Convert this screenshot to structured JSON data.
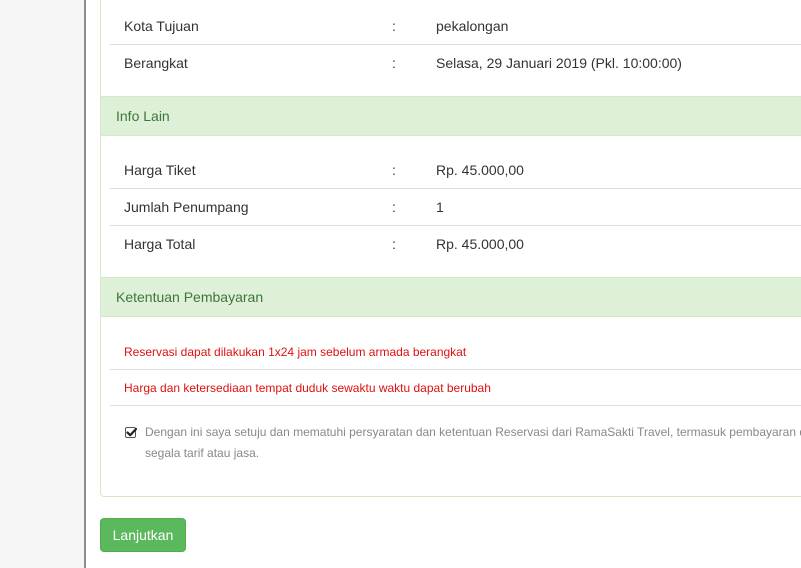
{
  "trip": {
    "rows": [
      {
        "label": "Kota Tujuan",
        "colon": ":",
        "value": "pekalongan"
      },
      {
        "label": "Berangkat",
        "colon": ":",
        "value": "Selasa, 29 Januari 2019 (Pkl. 10:00:00)"
      }
    ]
  },
  "info_lain": {
    "heading": "Info Lain",
    "rows": [
      {
        "label": "Harga Tiket",
        "colon": ":",
        "value": "Rp. 45.000,00"
      },
      {
        "label": "Jumlah Penumpang",
        "colon": ":",
        "value": "1"
      },
      {
        "label": "Harga Total",
        "colon": ":",
        "value": "Rp. 45.000,00"
      }
    ]
  },
  "ketentuan": {
    "heading": "Ketentuan Pembayaran",
    "notices": [
      "Reservasi dapat dilakukan 1x24 jam sebelum armada berangkat",
      "Harga dan ketersediaan tempat duduk sewaktu waktu dapat berubah"
    ],
    "agreement": {
      "checked": true,
      "text": "Dengan ini saya setuju dan mematuhi persyaratan dan ketentuan Reservasi dari RamaSakti Travel, termasuk pembayaran dari segala tarif atau jasa."
    }
  },
  "actions": {
    "next_label": "Lanjutkan"
  },
  "colors": {
    "panel_border": "#d6e9c6",
    "section_bg": "#dff0d8",
    "section_text": "#3c763d",
    "notice_text": "#e01010",
    "button_bg": "#5cb85c"
  }
}
